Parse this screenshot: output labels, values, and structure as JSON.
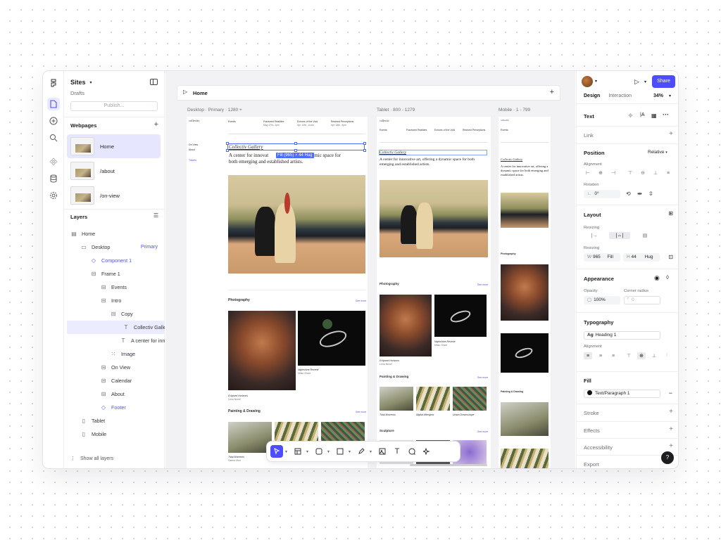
{
  "sidebar": {
    "site_name": "Sites",
    "site_status": "Drafts",
    "publish_label": "Publish...",
    "webpages_title": "Webpages",
    "pages": [
      {
        "label": "Home"
      },
      {
        "label": "/about"
      },
      {
        "label": "/on-view"
      }
    ],
    "layers_title": "Layers",
    "layers": [
      {
        "label": "Home",
        "icon": "page-icon",
        "indent": 0
      },
      {
        "label": "Desktop",
        "icon": "desktop-icon",
        "indent": 1,
        "tag": "Primary"
      },
      {
        "label": "Component 1",
        "icon": "component-icon",
        "indent": 2,
        "blue": true
      },
      {
        "label": "Frame 1",
        "icon": "frame-icon",
        "indent": 2
      },
      {
        "label": "Events",
        "icon": "frame-icon",
        "indent": 3
      },
      {
        "label": "Intro",
        "icon": "frame-icon",
        "indent": 3
      },
      {
        "label": "Copy",
        "icon": "frame-icon",
        "indent": 4
      },
      {
        "label": "Collectiv Galler",
        "icon": "text-icon",
        "indent": 5,
        "selected": true
      },
      {
        "label": "A center for inn",
        "icon": "text-icon",
        "indent": 5
      },
      {
        "label": "Image",
        "icon": "image-icon",
        "indent": 4
      },
      {
        "label": "On View",
        "icon": "frame-icon",
        "indent": 3
      },
      {
        "label": "Calendar",
        "icon": "frame-icon",
        "indent": 3
      },
      {
        "label": "About",
        "icon": "frame-icon",
        "indent": 3
      },
      {
        "label": "Footer",
        "icon": "component-icon",
        "indent": 3,
        "blue": true
      },
      {
        "label": "Tablet",
        "icon": "tablet-icon",
        "indent": 1
      },
      {
        "label": "Mobile",
        "icon": "mobile-icon",
        "indent": 1
      }
    ],
    "show_all_label": "Show all layers"
  },
  "canvas": {
    "page_title": "Home",
    "frames": {
      "desktop": "Desktop · Primary · 1280 +",
      "tablet": "Tablet · 800 - 1279",
      "mobile": "Mobile · 1 - 799"
    },
    "site_logo": "collectiv",
    "desktop_nav": [
      "On View",
      "About",
      "Tickets"
    ],
    "gallery_title": "Collectiv Gallery",
    "intro_text": "A center for innovative art, offering a dynamic space for both emerging and established artists.",
    "intro_text_desktop_start": "A center for innovat",
    "intro_text_desktop_end": "ynamic space for",
    "intro_text_desktop_line2": "both emerging and established artists.",
    "selection_badge": "Fill (965) × 44 Hug",
    "events": [
      {
        "title": "Fractured Realities",
        "date": "May 27th, 2pm"
      },
      {
        "title": "Echoes of the Void",
        "date": "Apr 10th, 11am"
      },
      {
        "title": "Resined Perceptions",
        "date": "Apr 18th, 4pm"
      }
    ],
    "sections": {
      "photography": "Photography",
      "painting": "Painting & Drawing",
      "sculpture": "Sculpture",
      "see_more": "See more"
    },
    "captions": [
      {
        "title": "Eclipsed Horizons",
        "artist": "Lena Novel"
      },
      {
        "title": "Nightshine Reverie",
        "artist": "Mitsu Grant"
      },
      {
        "title": "Tidal Moments",
        "artist": "Sanna Mori"
      },
      {
        "title": "Digital Afterglow",
        "artist": "Harper Quinn"
      },
      {
        "title": "Urban Dreamscape",
        "artist": "Dominic Ward"
      }
    ]
  },
  "toolbar": {
    "tools": [
      "cursor-icon",
      "frame-icon",
      "shape-icon",
      "rectangle-icon",
      "pen-icon",
      "image-icon",
      "text-icon",
      "comment-icon",
      "ai-icon"
    ]
  },
  "inspector": {
    "share_label": "Share",
    "tabs": {
      "design": "Design",
      "interaction": "Interaction"
    },
    "zoom": "34%",
    "text_title": "Text",
    "link": "Link",
    "position": {
      "title": "Position",
      "value": "Relative",
      "alignment": "Alignment",
      "rotation": "Rotation",
      "rotation_value": "0°"
    },
    "layout": {
      "title": "Layout",
      "resizing": "Resizing",
      "resizing2": "Resizing",
      "w_label": "W",
      "w_value": "965",
      "w_mode": "Fill",
      "h_label": "H",
      "h_value": "44",
      "h_mode": "Hug"
    },
    "appearance": {
      "title": "Appearance",
      "opacity_label": "Opacity",
      "opacity": "100%",
      "radius_label": "Corner radius",
      "radius": "0"
    },
    "typography": {
      "title": "Typography",
      "style": "Heading 1",
      "alignment": "Alignment"
    },
    "fill": {
      "title": "Fill",
      "value": "Text/Paragraph 1"
    },
    "stroke": "Stroke",
    "effects": "Effects",
    "accessibility": "Accessibility",
    "export": "Export",
    "help": "?"
  },
  "colors": {
    "accent": "#4d4dff",
    "selection": "#4d6bff",
    "layer_blue": "#4f55e8"
  }
}
